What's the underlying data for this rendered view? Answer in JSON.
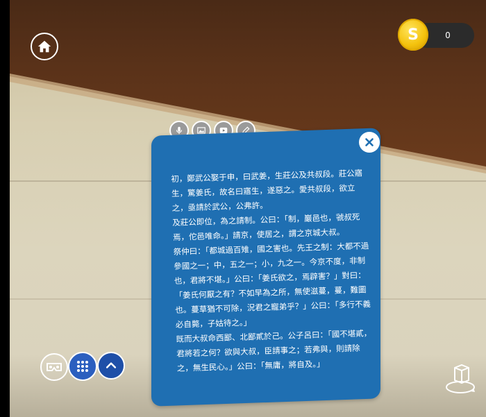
{
  "coin": {
    "symbol": "S",
    "count": "0"
  },
  "panel": {
    "paragraphs": [
      "初，鄭武公娶于申，曰武姜，生莊公及共叔段。莊公寤生，驚姜氏，故名曰寤生，遂惡之。愛共叔段，欲立之，亟請於武公，公弗許。",
      "及莊公即位，為之請制。公曰：「制，巖邑也，虢叔死焉，佗邑唯命。」請京，使居之，謂之京城大叔。",
      "祭仲曰：「都城過百雉，國之害也。先王之制：大都不過參國之一；中，五之一；小，九之一。今京不度，非制也，君將不堪。」公曰：「姜氏欲之，焉辟害？」對曰：「姜氏何厭之有？不如早為之所，無使滋蔓，蔓，難圖也。蔓草猶不可除，況君之寵弟乎？」公曰：「多行不義必自斃，子姑待之。」",
      "既而大叔命西鄙、北鄙貳於己。公子呂曰：「國不堪貳，君將若之何？欲與大叔，臣請事之；若弗與，則請除之，無生民心。」公曰：「無庸，將自及。」"
    ]
  },
  "icons": {
    "home": "home-icon",
    "close": "close-icon",
    "vr": "vr-goggles-icon",
    "grid": "grid-menu-icon",
    "up": "chevron-up-icon",
    "rotate": "rotate-3d-icon"
  },
  "colors": {
    "panel": "#1f6fb2",
    "coin": "#f4c20d",
    "grid_button": "#2b5fbf"
  }
}
